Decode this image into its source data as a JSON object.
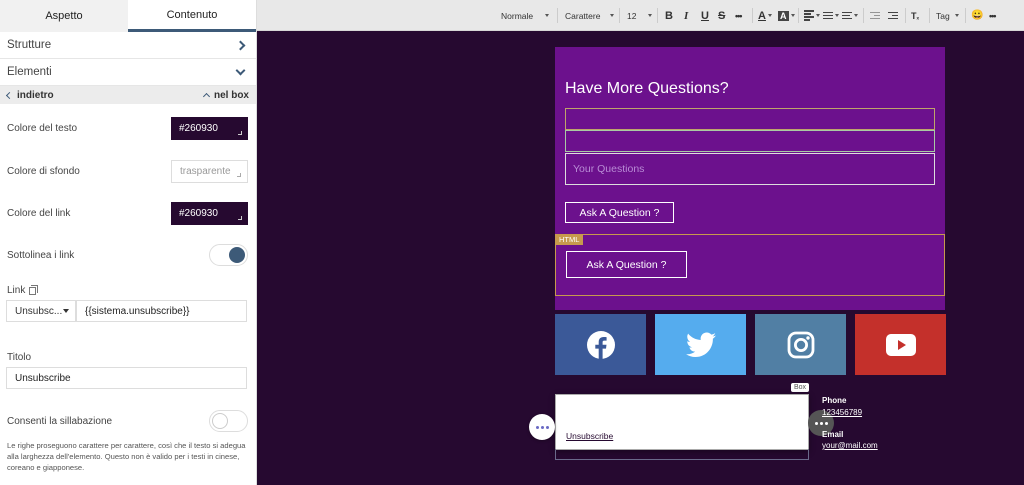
{
  "panel": {
    "tabs": [
      "Aspetto",
      "Contenuto"
    ],
    "sections": {
      "strutture": "Strutture",
      "elementi": "Elementi"
    },
    "back_label": "indietro",
    "context_label": "nel box",
    "text_color": {
      "label": "Colore del testo",
      "value": "#260930"
    },
    "bg_color": {
      "label": "Colore di sfondo",
      "value": "trasparente"
    },
    "link_color": {
      "label": "Colore del link",
      "value": "#260930"
    },
    "underline": {
      "label": "Sottolinea i link",
      "on": true
    },
    "link": {
      "label": "Link",
      "type": "Unsubsc...",
      "value": "{{sistema.unsubscribe}}"
    },
    "title": {
      "label": "Titolo",
      "value": "Unsubscribe"
    },
    "hyphen": {
      "label": "Consenti la sillabazione",
      "on": false
    },
    "help_text": "Le righe proseguono carattere per carattere, così che il testo si adegua alla larghezza dell'elemento. Questo non è valido per i testi in cinese, coreano e giapponese."
  },
  "toolbar": {
    "format": "Normale",
    "font": "Carattere",
    "size": "12",
    "bold": "B",
    "italic": "I",
    "underline": "U",
    "strike": "S",
    "more": "•••",
    "text_color": "A",
    "bg_color": "A",
    "tag": "Tag",
    "emoji": "😀",
    "overflow": "•••"
  },
  "canvas": {
    "question_title": "Have More Questions?",
    "textarea_placeholder": "Your Questions",
    "button_label": "Ask A Question ?",
    "html_tag": "HTML",
    "html_button_label": "Ask A Question ?",
    "social": [
      {
        "name": "facebook",
        "color": "#3b5998"
      },
      {
        "name": "twitter",
        "color": "#55acee"
      },
      {
        "name": "instagram",
        "color": "#517fa4"
      },
      {
        "name": "youtube",
        "color": "#c4302b"
      }
    ],
    "box_tag": "Box",
    "unsubscribe_link": "Unsubscribe",
    "phone_heading": "Phone",
    "phone_value": "123456789",
    "email_heading": "Email",
    "email_value": "your@mail.com"
  },
  "colors": {
    "canvas_bg": "#260930",
    "card_bg": "#6c118d",
    "accent": "#3d5a78"
  }
}
